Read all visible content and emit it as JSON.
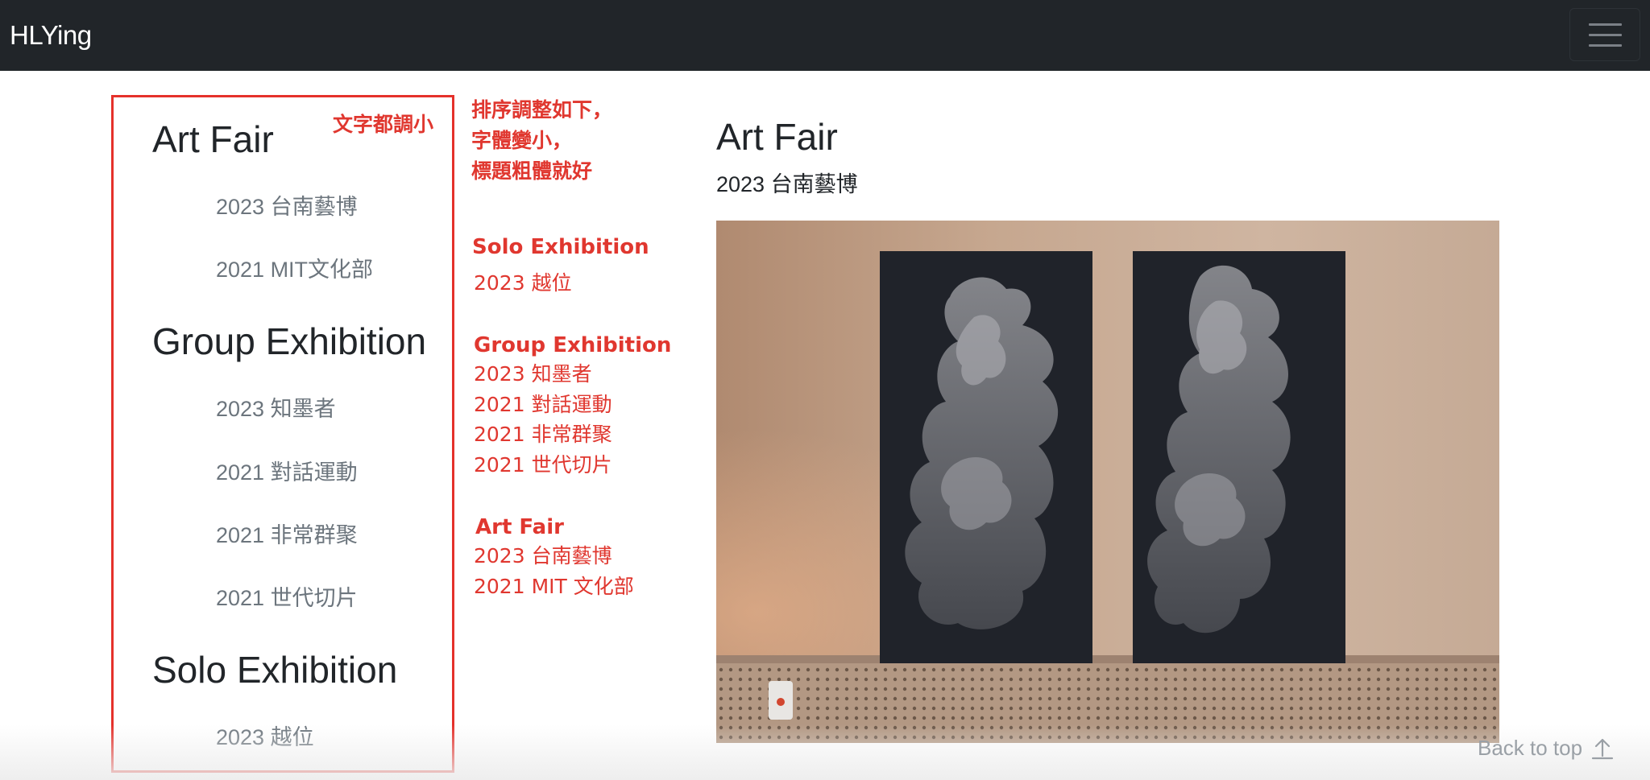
{
  "navbar": {
    "brand": "HLYing",
    "menu_icon": "hamburger-menu-icon"
  },
  "sidebar": {
    "sections": [
      {
        "heading": "Art Fair",
        "links": [
          "2023 台南藝博",
          "2021 MIT文化部"
        ]
      },
      {
        "heading": "Group Exhibition",
        "links": [
          "2023 知墨者",
          "2021 對話運動",
          "2021 非常群聚",
          "2021 世代切片"
        ]
      },
      {
        "heading": "Solo Exhibition",
        "links": [
          "2023 越位"
        ]
      }
    ]
  },
  "annotations": {
    "box_note": "文字都調小",
    "instruction_lines": [
      "排序調整如下，",
      "字體變小，",
      "標題粗體就好"
    ],
    "order": [
      {
        "heading": "Solo Exhibition",
        "items": [
          "2023 越位"
        ]
      },
      {
        "heading": "Group Exhibition",
        "items": [
          "2023 知墨者",
          "2021 對話運動",
          "2021 非常群聚",
          "2021 世代切片"
        ]
      },
      {
        "heading": "Art Fair",
        "items": [
          "2023 台南藝博",
          "2021 MIT 文化部"
        ]
      }
    ],
    "color": "#e0372f"
  },
  "main": {
    "title": "Art Fair",
    "subtitle": "2023 台南藝博",
    "image_subject": "two dark panels with silver rock-mountain drawings on a beige wall"
  },
  "footer": {
    "back_to_top": "Back to top",
    "back_to_top_icon": "arrow-up-icon"
  },
  "colors": {
    "navbar_bg": "#212529",
    "annotation_red": "#e0372f",
    "link_gray": "#6c757d"
  }
}
